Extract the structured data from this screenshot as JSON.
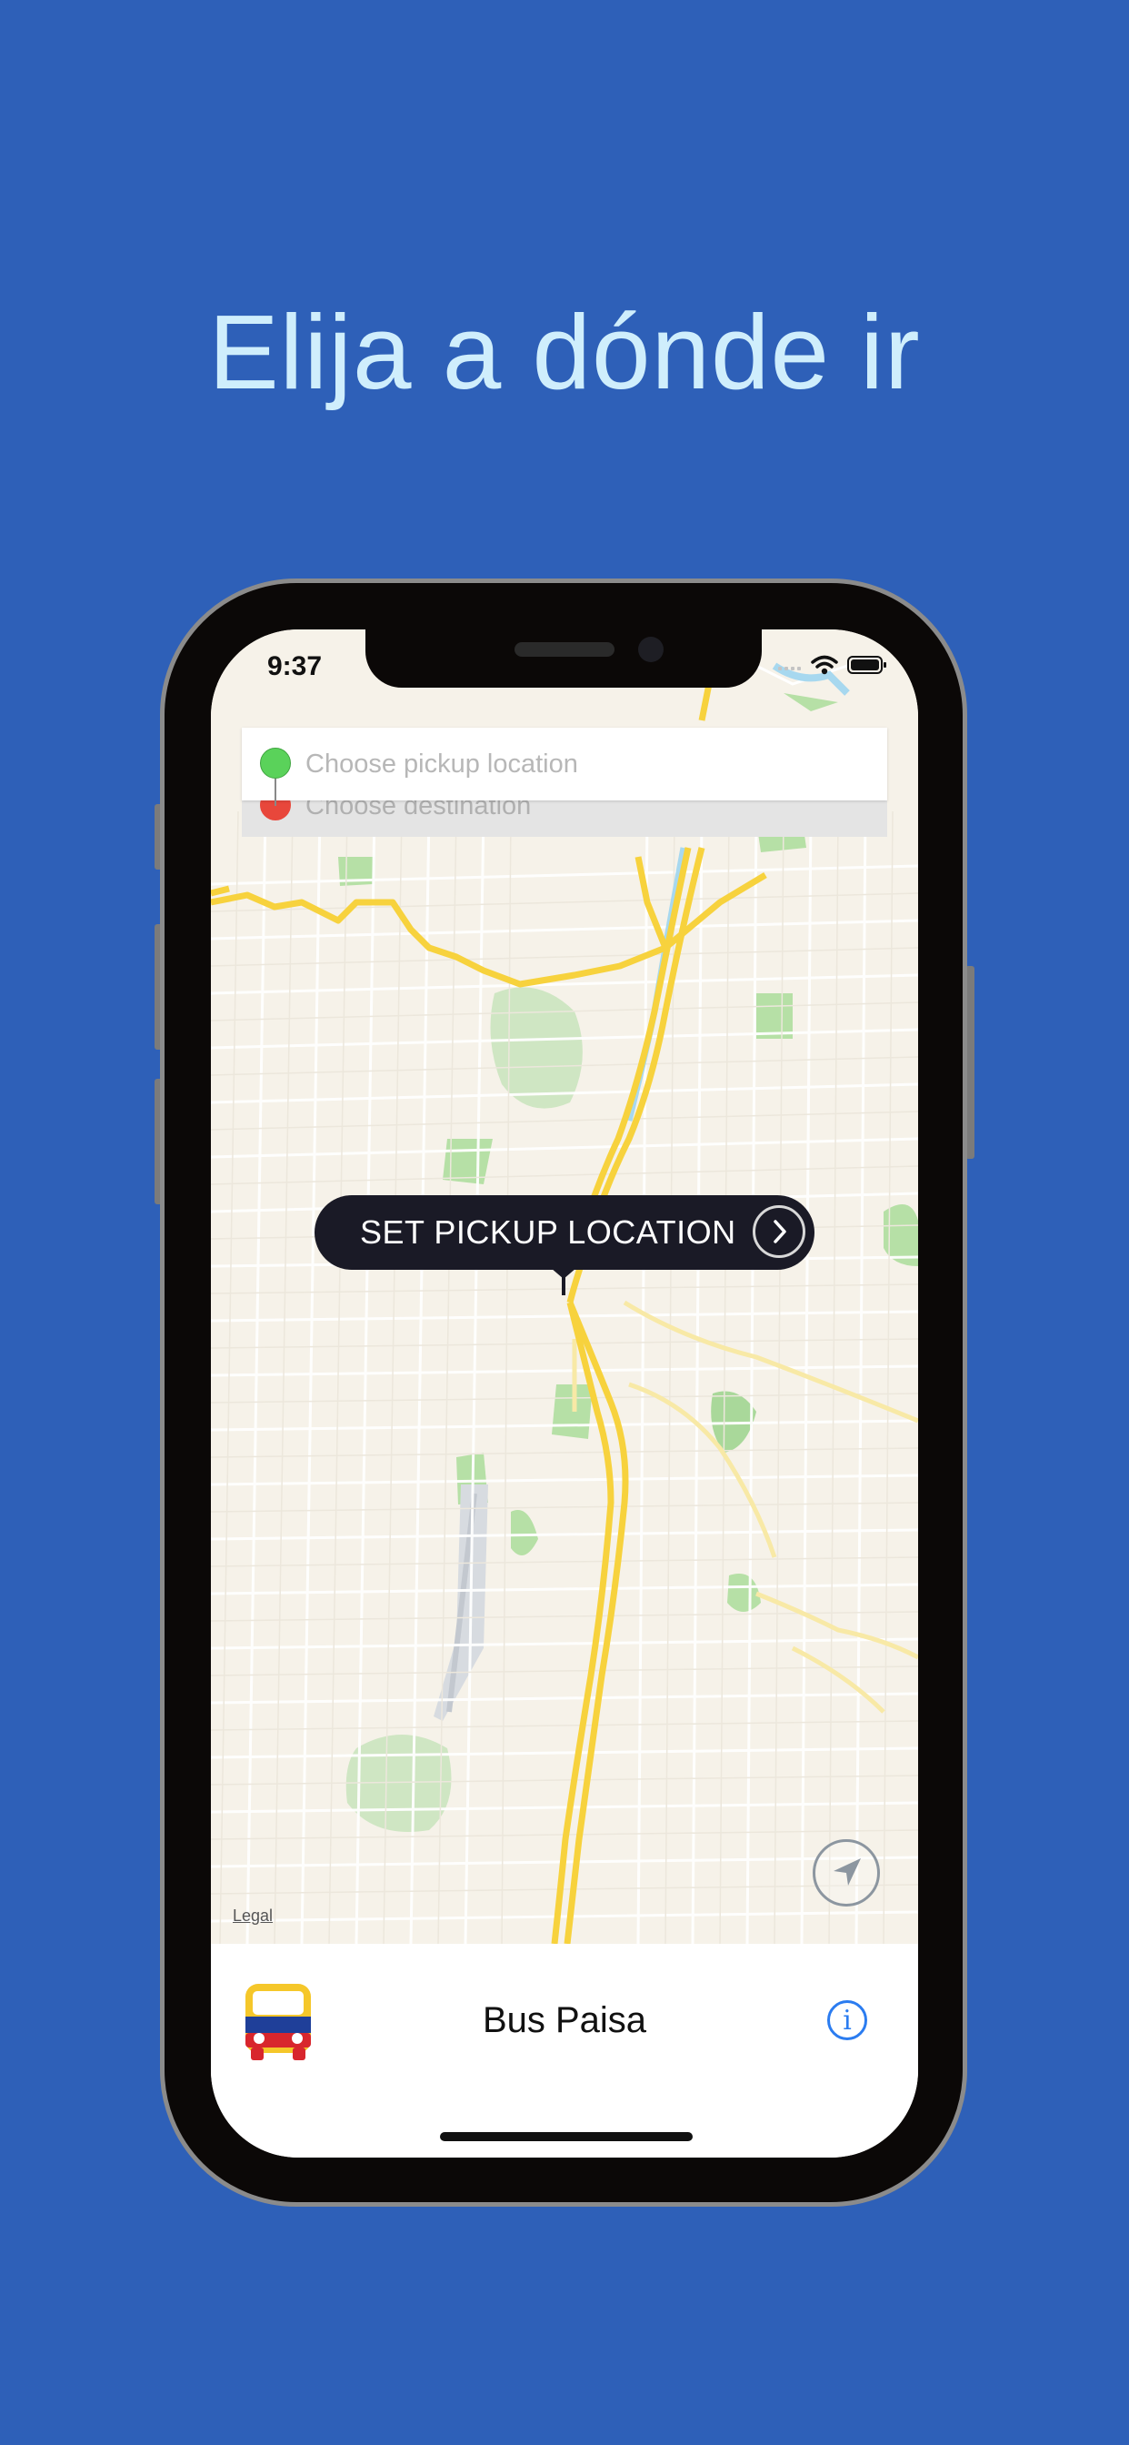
{
  "promo": {
    "headline": "Elija a dónde ir"
  },
  "status_bar": {
    "time": "9:37"
  },
  "search": {
    "pickup_placeholder": "Choose pickup location",
    "destination_placeholder": "Choose destination"
  },
  "map": {
    "pin_label": "SET PICKUP LOCATION",
    "legal": "Legal"
  },
  "bottom_bar": {
    "app_name": "Bus Paisa",
    "info_glyph": "i"
  },
  "colors": {
    "background": "#2e60b8",
    "headline": "#cfeefc",
    "pickup_dot": "#5ad25a",
    "destination_dot": "#e8473b",
    "highway": "#f7d23d",
    "info_accent": "#2b7cf0"
  },
  "icons": [
    "wifi-icon",
    "battery-icon",
    "chevron-right-icon",
    "location-arrow-icon",
    "bus-icon",
    "info-icon"
  ]
}
